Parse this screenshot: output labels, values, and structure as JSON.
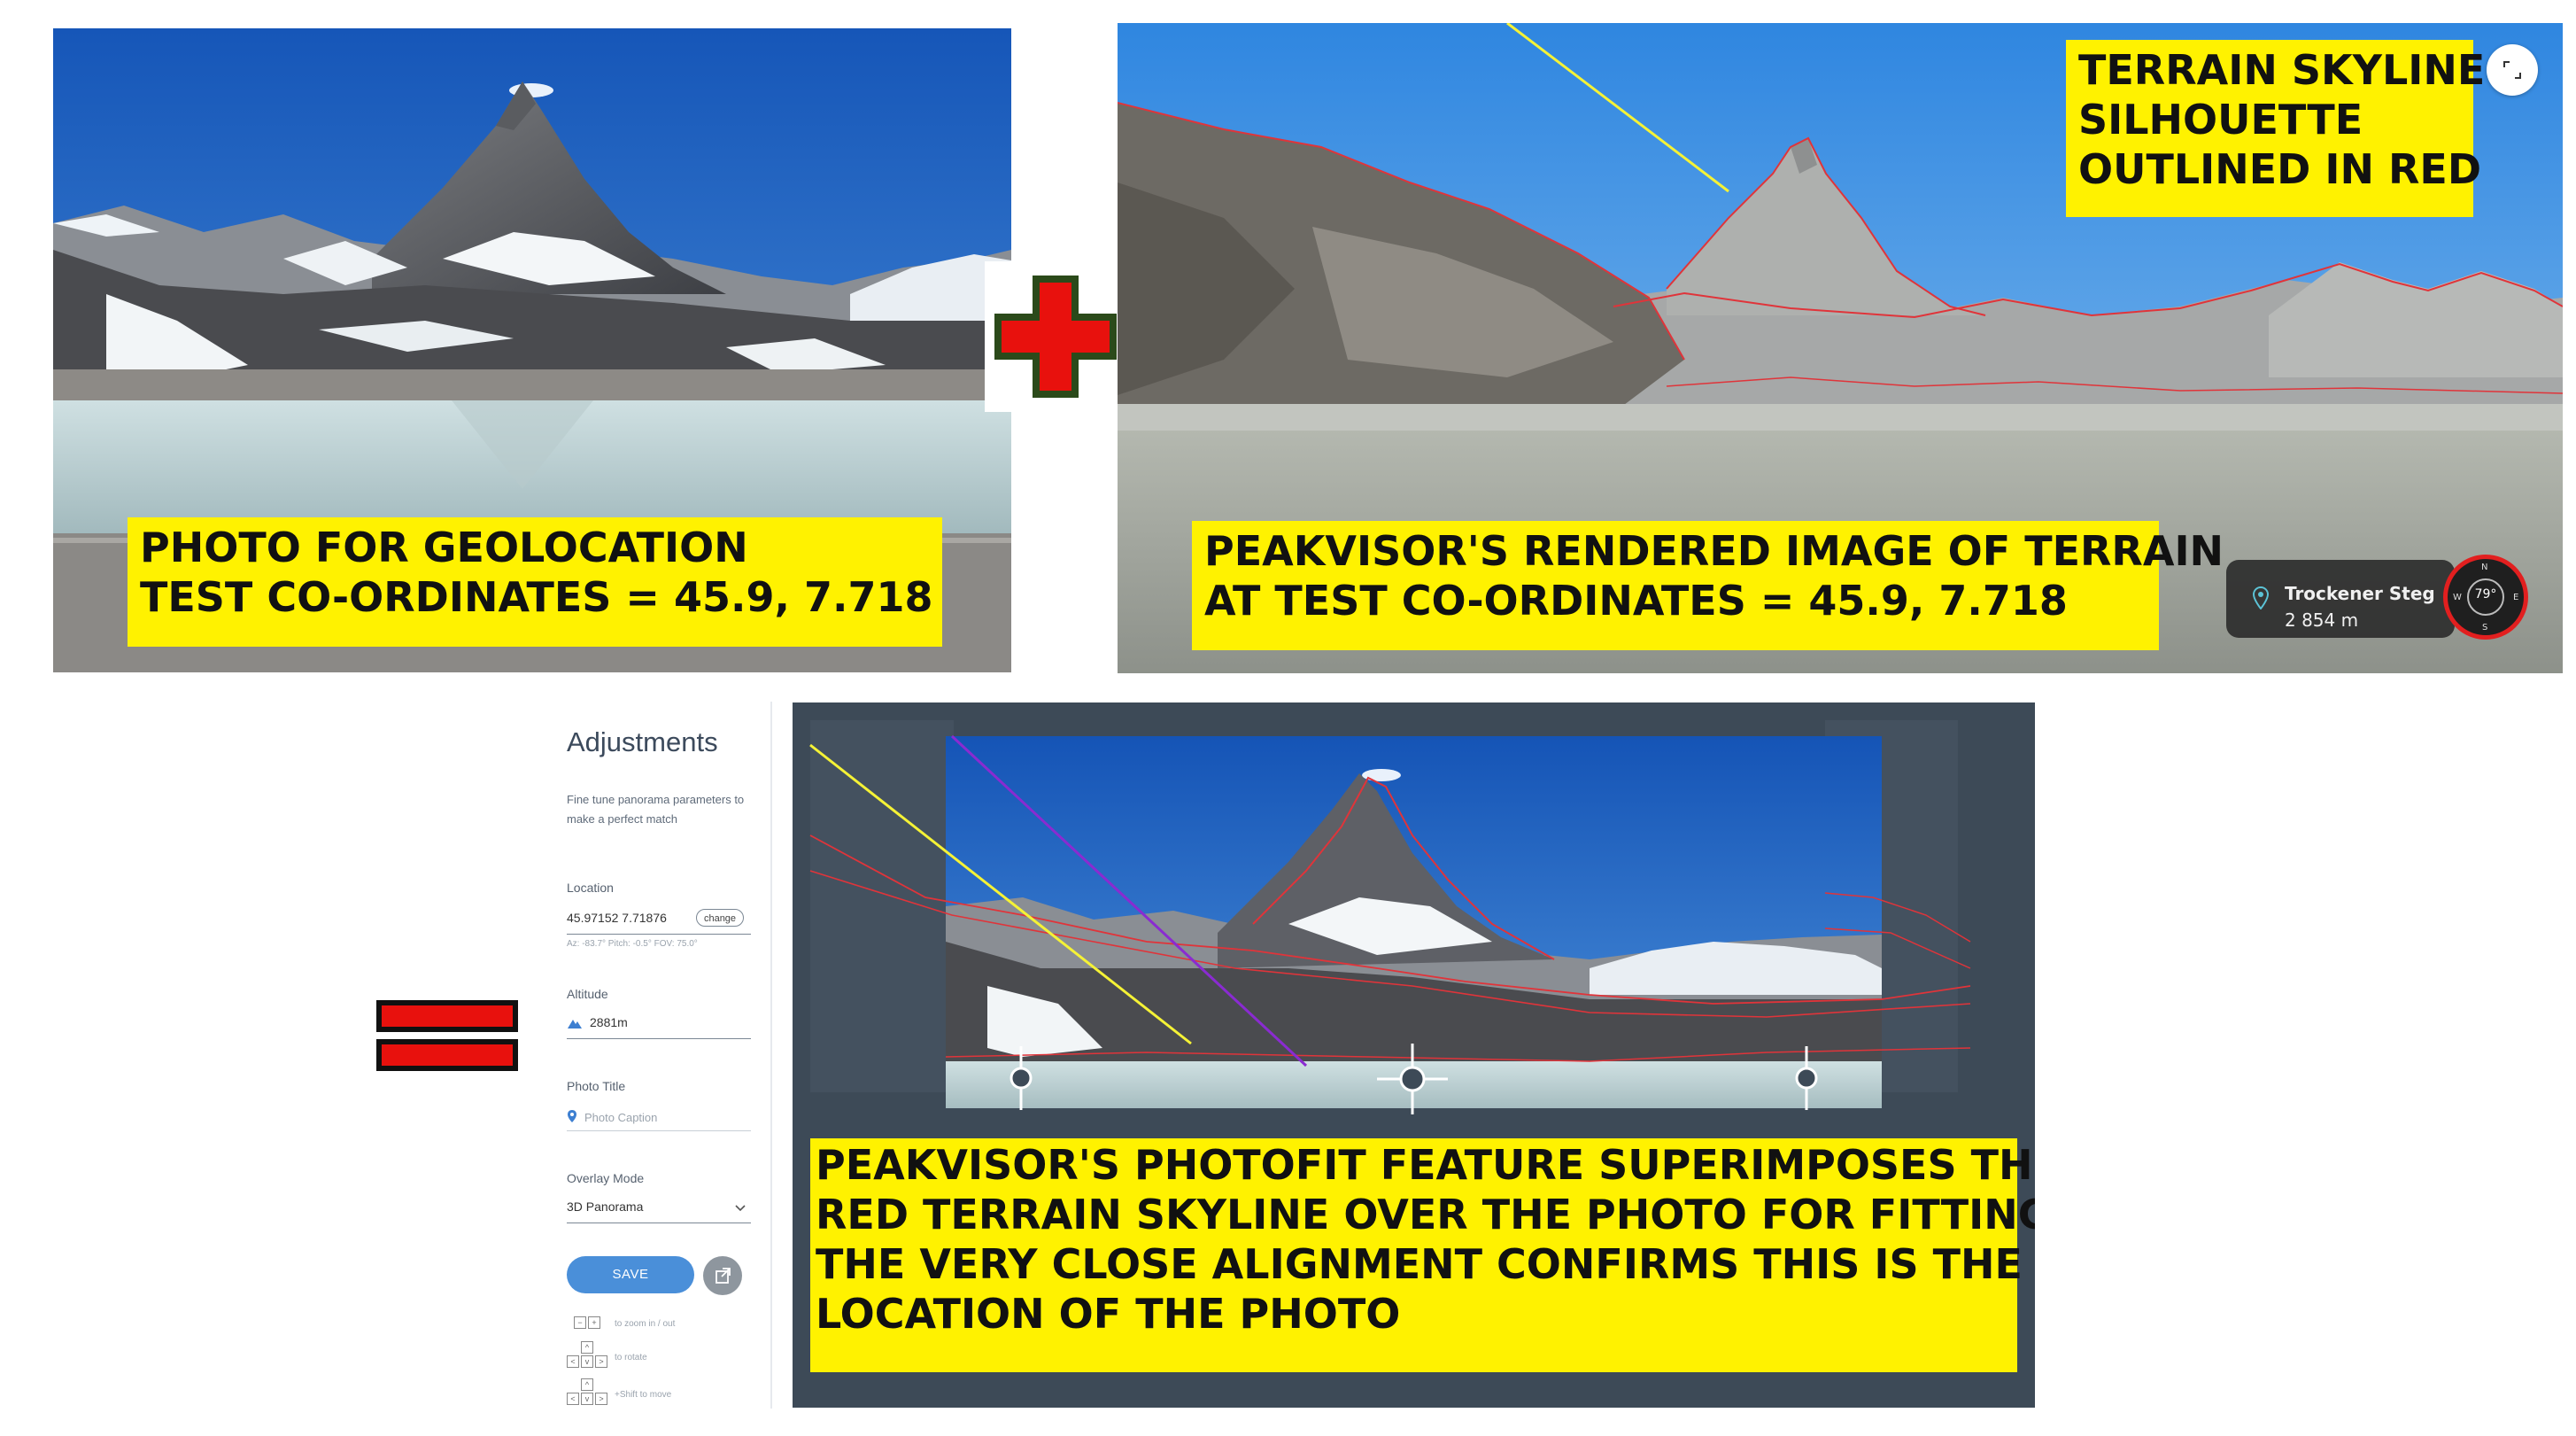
{
  "captions": {
    "photo": {
      "line1": "PHOTO FOR GEOLOCATION",
      "line2": "TEST CO-ORDINATES = 45.9, 7.718"
    },
    "render_skyline": {
      "line1": "TERRAIN SKYLINE",
      "line2": "SILHOUETTE",
      "line3": "OUTLINED IN RED"
    },
    "render": {
      "line1": "PEAKVISOR'S RENDERED IMAGE OF TERRAIN",
      "line2": "AT TEST CO-ORDINATES = 45.9, 7.718"
    },
    "photofit": {
      "line1": "PEAKVISOR'S PHOTOFIT FEATURE SUPERIMPOSES THE",
      "line2": "RED TERRAIN SKYLINE OVER THE PHOTO FOR FITTING -",
      "line3": "THE VERY CLOSE ALIGNMENT CONFIRMS THIS IS THE",
      "line4": "LOCATION OF THE PHOTO"
    }
  },
  "poi": {
    "name": "Trockener Steg",
    "altitude": "2 854 m"
  },
  "compass": {
    "reading": "79°",
    "n": "N",
    "s": "S",
    "w": "W",
    "e": "E"
  },
  "adjustments": {
    "title": "Adjustments",
    "description": "Fine tune panorama parameters to make a perfect match",
    "location_label": "Location",
    "location_value": "45.97152 7.71876",
    "change_label": "change",
    "orientation_hint": "Az: -83.7° Pitch: -0.5° FOV: 75.0°",
    "altitude_label": "Altitude",
    "altitude_value": "2881m",
    "photo_title_label": "Photo Title",
    "photo_caption_placeholder": "Photo Caption",
    "overlay_mode_label": "Overlay Mode",
    "overlay_mode_value": "3D Panorama",
    "save_label": "SAVE",
    "hint_zoom": "to zoom in / out",
    "hint_rotate": "to rotate",
    "hint_move": "+Shift to move"
  },
  "colors": {
    "caption_yellow": "#fff200",
    "skyline_red": "#e0343a",
    "plus_red": "#e8110d",
    "plus_border": "#2b4a1a",
    "save_blue": "#4a8fd9",
    "frame_bg": "#3d4a57"
  },
  "icons": {
    "plus": "plus-sign-icon",
    "equals": "equals-sign-icon",
    "expand": "expand-icon",
    "pin": "location-pin-icon",
    "compass": "compass-icon",
    "share": "share-icon",
    "mountain": "mountain-icon",
    "chevron": "chevron-down-icon"
  }
}
